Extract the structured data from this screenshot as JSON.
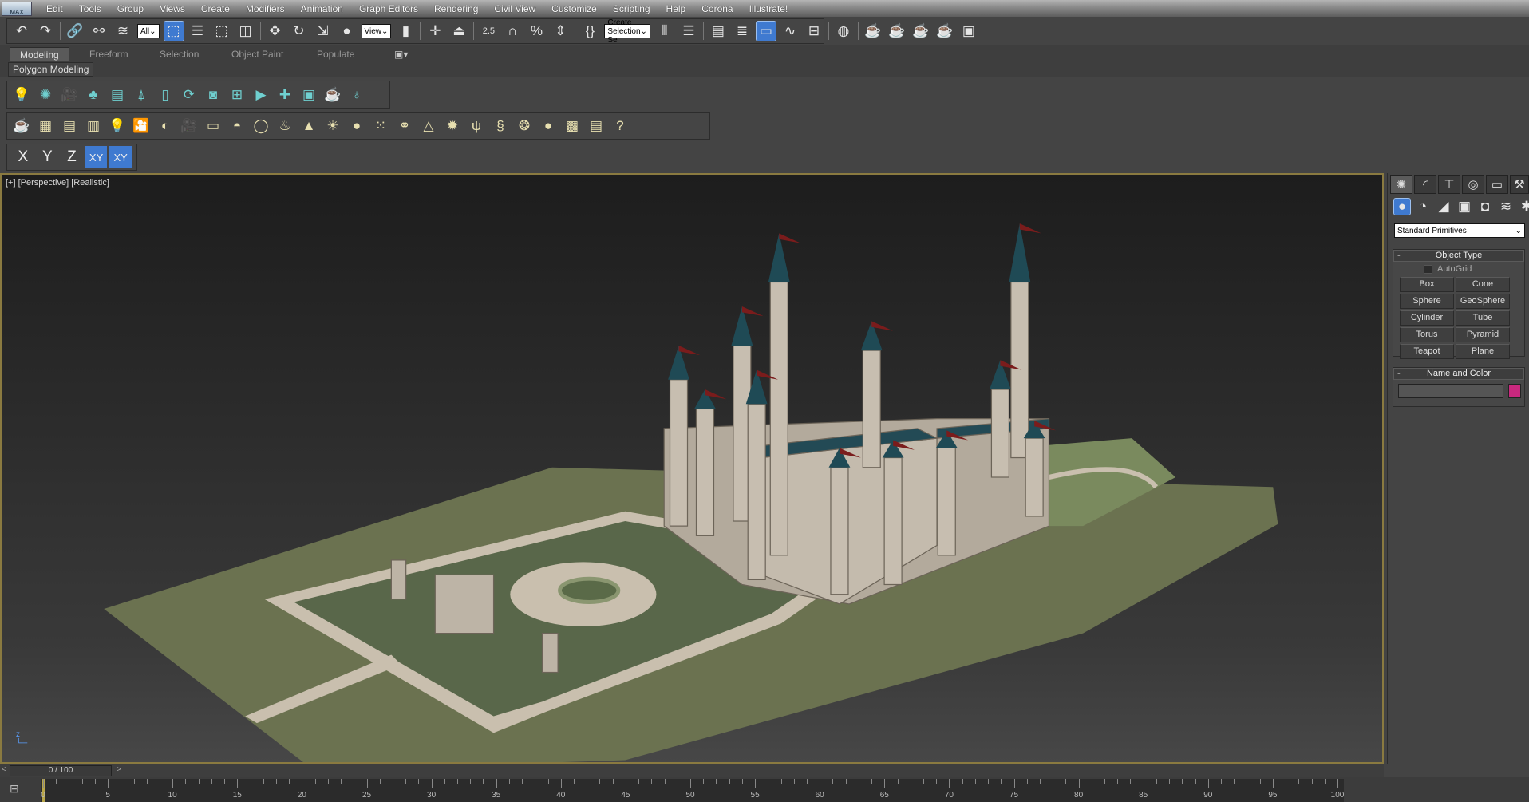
{
  "app": {
    "logo": "MAX"
  },
  "menu": [
    "Edit",
    "Tools",
    "Group",
    "Views",
    "Create",
    "Modifiers",
    "Animation",
    "Graph Editors",
    "Rendering",
    "Civil View",
    "Customize",
    "Scripting",
    "Help",
    "Corona",
    "Illustrate!"
  ],
  "main_toolbar": {
    "selection_filter": "All",
    "ref_coord": "View",
    "named_selection": "Create Selection Se",
    "snap_label": "2.5"
  },
  "ribbon": {
    "tabs": [
      "Modeling",
      "Freeform",
      "Selection",
      "Object Paint",
      "Populate"
    ],
    "active_tab": "Modeling",
    "panel_label": "Polygon Modeling"
  },
  "toolbar2": [
    [
      "light-icon",
      "💡"
    ],
    [
      "omni-light-icon",
      "✺"
    ],
    [
      "camera-icon",
      "🎥"
    ],
    [
      "trees-icon",
      "♣"
    ],
    [
      "list-icon",
      "▤"
    ],
    [
      "tree-icon",
      "⍋"
    ],
    [
      "tree-card-icon",
      "▯"
    ],
    [
      "rotate-icon",
      "⟳"
    ],
    [
      "display-icon",
      "◙"
    ],
    [
      "viewport-icon",
      "⊞"
    ],
    [
      "render-frame-icon",
      "▶"
    ],
    [
      "camera-add-icon",
      "✚"
    ],
    [
      "panel-icon",
      "▣"
    ],
    [
      "teapot-icon",
      "☕"
    ],
    [
      "bulb-icon",
      "♁"
    ]
  ],
  "toolbar3": [
    [
      "teapot-icon",
      "☕"
    ],
    [
      "render-window-icon",
      "▦"
    ],
    [
      "table-icon",
      "▤"
    ],
    [
      "table2-icon",
      "▥"
    ],
    [
      "light-list-icon",
      "💡"
    ],
    [
      "camera-icon",
      "🎦"
    ],
    [
      "sphere-half-icon",
      "◐"
    ],
    [
      "film-camera-icon",
      "🎥"
    ],
    [
      "plane-light-icon",
      "▭"
    ],
    [
      "dome-icon",
      "◓"
    ],
    [
      "sphere-light-icon",
      "◯"
    ],
    [
      "basket-icon",
      "♨"
    ],
    [
      "cone-icon",
      "▲"
    ],
    [
      "sun-icon",
      "☀"
    ],
    [
      "disc-light-icon",
      "●"
    ],
    [
      "particles-icon",
      "⁙"
    ],
    [
      "molecule-icon",
      "⚭"
    ],
    [
      "pyramid-icon",
      "△"
    ],
    [
      "gear-sphere-icon",
      "✹"
    ],
    [
      "grass-icon",
      "ψ"
    ],
    [
      "hair-icon",
      "§"
    ],
    [
      "fur-icon",
      "❂"
    ],
    [
      "material-sphere-icon",
      "●"
    ],
    [
      "material-browser-icon",
      "▩"
    ],
    [
      "render-setup-icon",
      "▤"
    ],
    [
      "help-icon",
      "?"
    ]
  ],
  "axis_constraints": [
    "X",
    "Y",
    "Z",
    "XY",
    "XY"
  ],
  "viewport": {
    "label": "[+] [Perspective] [Realistic]"
  },
  "command_panel": {
    "category": "Standard Primitives",
    "object_type_title": "Object Type",
    "autogrid": "AutoGrid",
    "buttons": [
      "Box",
      "Cone",
      "Sphere",
      "GeoSphere",
      "Cylinder",
      "Tube",
      "Torus",
      "Pyramid",
      "Teapot",
      "Plane"
    ],
    "name_color_title": "Name and Color",
    "name_value": "",
    "object_color": "#c8287e"
  },
  "timeline": {
    "frame": "0 / 100",
    "labels": [
      "0",
      "5",
      "10",
      "15",
      "20",
      "25",
      "30",
      "35",
      "40",
      "45",
      "50",
      "55",
      "60",
      "65",
      "70",
      "75",
      "80",
      "85",
      "90",
      "95",
      "100"
    ]
  },
  "colors": {
    "accent": "#3f7ad0",
    "viewport_border": "#8a7a40"
  }
}
